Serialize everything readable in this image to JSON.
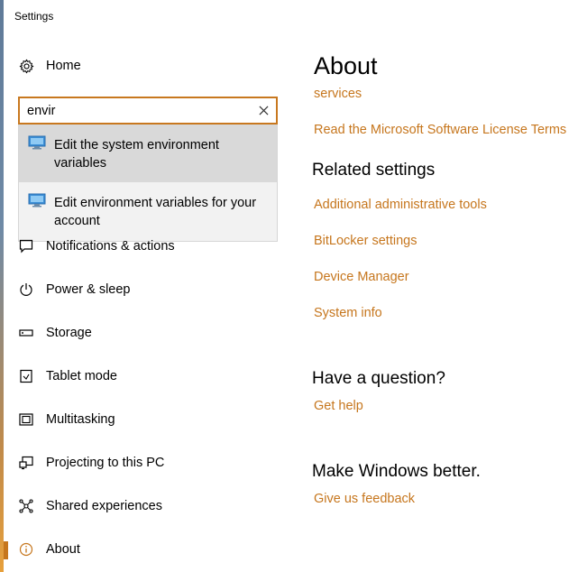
{
  "window": {
    "title": "Settings"
  },
  "nav": {
    "home_label": "Home",
    "items": [
      {
        "label": "Notifications & actions",
        "icon": "notification-icon"
      },
      {
        "label": "Power & sleep",
        "icon": "power-icon"
      },
      {
        "label": "Storage",
        "icon": "storage-icon"
      },
      {
        "label": "Tablet mode",
        "icon": "tablet-icon"
      },
      {
        "label": "Multitasking",
        "icon": "multitasking-icon"
      },
      {
        "label": "Projecting to this PC",
        "icon": "projecting-icon"
      },
      {
        "label": "Shared experiences",
        "icon": "shared-icon"
      },
      {
        "label": "About",
        "icon": "info-icon"
      }
    ]
  },
  "search": {
    "value": "envir",
    "results": [
      {
        "label": "Edit the system environment variables"
      },
      {
        "label": "Edit environment variables for your account"
      }
    ]
  },
  "main": {
    "title": "About",
    "partial_link": "services",
    "license_link": "Read the Microsoft Software License Terms",
    "related_heading": "Related settings",
    "related_links": [
      "Additional administrative tools",
      "BitLocker settings",
      "Device Manager",
      "System info"
    ],
    "question_heading": "Have a question?",
    "help_link": "Get help",
    "better_heading": "Make Windows better.",
    "feedback_link": "Give us feedback"
  },
  "colors": {
    "accent": "#c6761d",
    "search_border": "#c8781f"
  }
}
